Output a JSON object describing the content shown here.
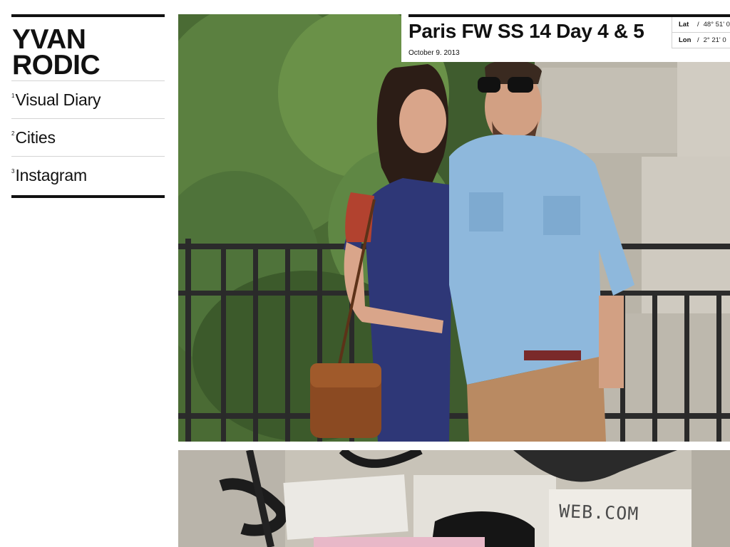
{
  "site": {
    "logo_line1": "YVAN",
    "logo_line2": "RODIC"
  },
  "nav": [
    {
      "num": "1",
      "label": "Visual Diary"
    },
    {
      "num": "2",
      "label": "Cities"
    },
    {
      "num": "3",
      "label": "Instagram"
    }
  ],
  "post": {
    "title": "Paris FW SS 14 Day 4 & 5",
    "date": "October 9. 2013",
    "lat_label": "Lat",
    "lat_value": "48° 51' 0",
    "lon_label": "Lon",
    "lon_value": "2° 21' 0",
    "coord_separator": "/"
  },
  "photo2": {
    "visible_text": "WEB.COM"
  }
}
